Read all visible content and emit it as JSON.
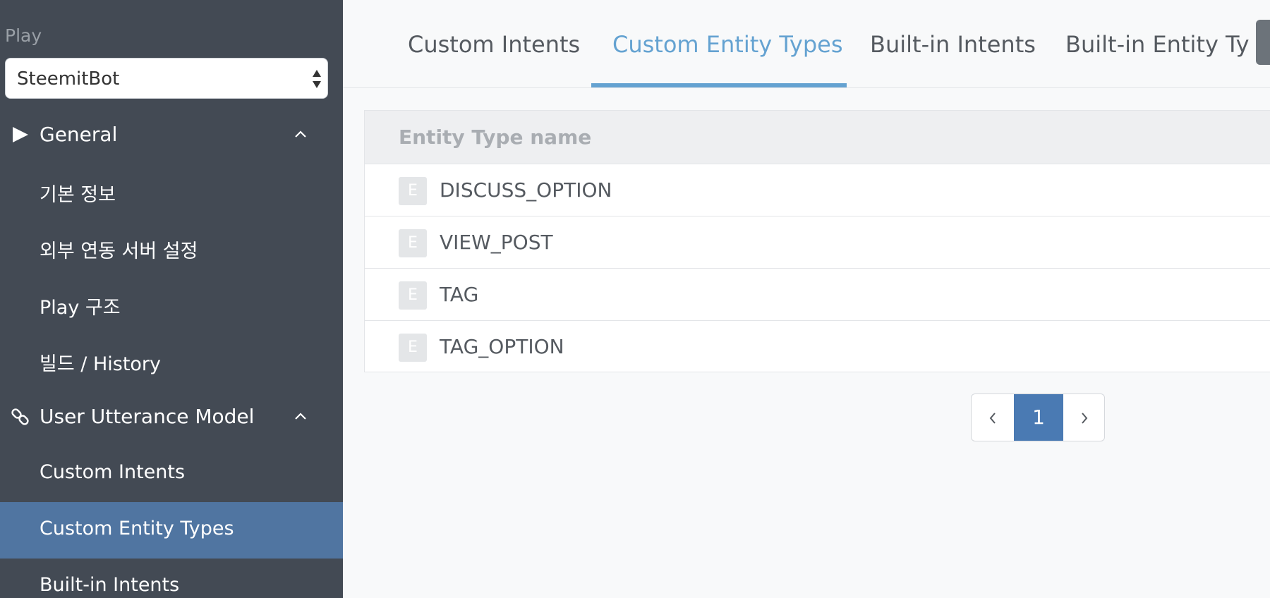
{
  "sidebar": {
    "section_label": "Play",
    "play_select": {
      "value": "SteemitBot"
    },
    "sections": [
      {
        "label": "General",
        "icon": "play-triangle-icon",
        "items": [
          "기본 정보",
          "외부 연동 서버 설정",
          "Play 구조",
          "빌드 / History"
        ]
      },
      {
        "label": "User Utterance Model",
        "icon": "link-icon",
        "items": [
          "Custom Intents",
          "Custom Entity Types",
          "Built-in Intents"
        ]
      }
    ],
    "active_item": "Custom Entity Types",
    "active_color": "#5075a1"
  },
  "tabs": [
    {
      "label": "Custom Intents",
      "active": false
    },
    {
      "label": "Custom Entity Types",
      "active": true
    },
    {
      "label": "Built-in Intents",
      "active": false
    },
    {
      "label": "Built-in Entity Ty",
      "active": false
    }
  ],
  "accent_color": "#64a2d1",
  "table": {
    "header": "Entity Type name",
    "badge_letter": "E",
    "rows": [
      "DISCUSS_OPTION",
      "VIEW_POST",
      "TAG",
      "TAG_OPTION"
    ]
  },
  "pagination": {
    "current_page": "1",
    "prev_icon": "chevron-left-icon",
    "next_icon": "chevron-right-icon"
  }
}
